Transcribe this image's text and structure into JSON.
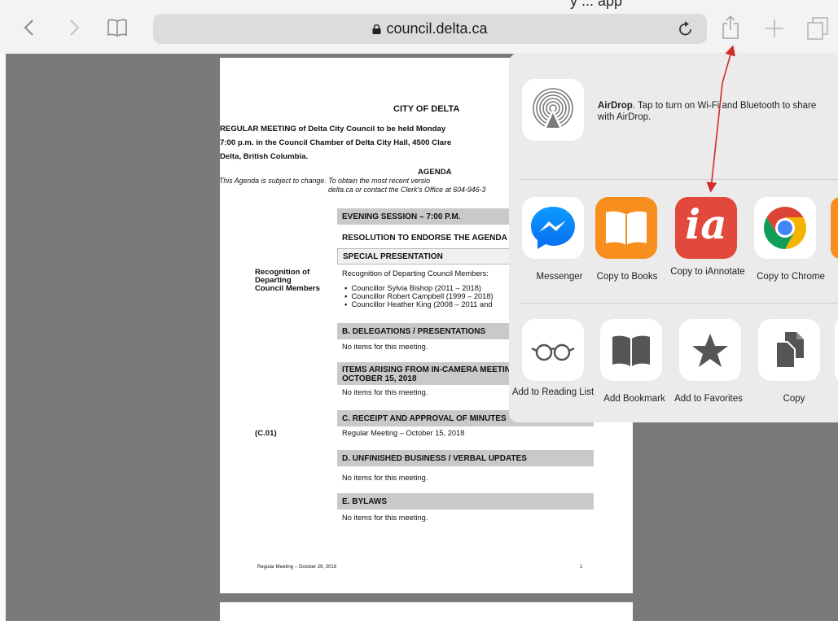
{
  "browser": {
    "top_caption": "y       ...   app",
    "url": "council.delta.ca"
  },
  "document": {
    "title": "CITY OF DELTA",
    "intro_lines": [
      "REGULAR MEETING of Delta City Council to be held Monday",
      "7:00 p.m. in the Council Chamber of Delta City Hall, 4500 Clare",
      "Delta, British Columbia."
    ],
    "agenda_heading": "AGENDA",
    "agenda_note_line1": "This Agenda is subject to change.  To obtain the most recent versio",
    "agenda_note_line2": "delta.ca or contact the Clerk's Office at 604-946-3",
    "sections": {
      "evening_session": "EVENING SESSION – 7:00 P.M.",
      "resolution": "RESOLUTION TO ENDORSE THE AGENDA",
      "special_presentation": "SPECIAL PRESENTATION",
      "delegations": "B.  DELEGATIONS / PRESENTATIONS",
      "items_arising_line1": "ITEMS ARISING FROM IN-CAMERA MEETIN",
      "items_arising_line2": "OCTOBER 15, 2018",
      "receipt_minutes": "C.  RECEIPT AND APPROVAL OF MINUTES",
      "unfinished_business": "D.  UNFINISHED BUSINESS / VERBAL UPDATES",
      "bylaws": "E.  BYLAWS"
    },
    "recognition_side_label": [
      "Recognition of",
      "Departing",
      "Council Members"
    ],
    "recognition_intro": "Recognition of Departing Council Members:",
    "councillors": [
      "Councillor Sylvia Bishop (2011 – 2018)",
      "Councillor Robert Campbell (1999 – 2018)",
      "Councillor Heather King (2008 – 2011 and"
    ],
    "no_items": "No items for this meeting.",
    "c01_label": "(C.01)",
    "c01_text": "Regular Meeting – October 15, 2018",
    "footer_left": "Regular Meeting – October 29, 2018",
    "footer_page": "1"
  },
  "share_sheet": {
    "airdrop_bold": "AirDrop",
    "airdrop_rest": ". Tap to turn on Wi-Fi and Bluetooth to share with AirDrop.",
    "apps": [
      {
        "label": "Messenger",
        "icon": "messenger-icon"
      },
      {
        "label": "Copy to Books",
        "icon": "books-icon"
      },
      {
        "label": "Copy to iAnnotate",
        "icon": "iannotate-icon"
      },
      {
        "label": "Copy to Chrome",
        "icon": "chrome-icon"
      }
    ],
    "actions": [
      {
        "label": "Add to Reading List",
        "icon": "reading-list-icon"
      },
      {
        "label": "Add Bookmark",
        "icon": "bookmark-icon"
      },
      {
        "label": "Add to Favorites",
        "icon": "star-icon"
      },
      {
        "label": "Copy",
        "icon": "copy-icon"
      }
    ],
    "iannotate_logo": "ia"
  },
  "colors": {
    "annotation_arrow": "#d42a2a",
    "books_orange": "#f78e1e",
    "iannotate_red": "#e2483b",
    "messenger_blue": "#0a7cff"
  }
}
